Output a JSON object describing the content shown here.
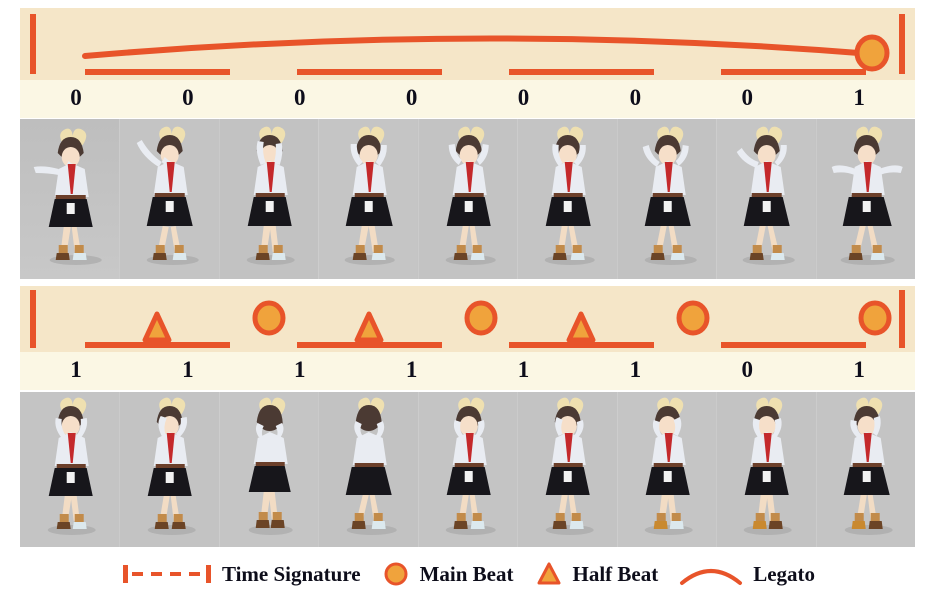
{
  "colors": {
    "page_bg": "#ffffff",
    "strip_bg": "#FBF7E4",
    "band_bg": "#F5E6C8",
    "accent_red": "#E8542A",
    "accent_orange": "#F0A33C",
    "frame_bg": "#C3C3C3",
    "digit": "#0d0d1a"
  },
  "rows": [
    {
      "name": "phrase-1",
      "notation": {
        "time_signature_bars": true,
        "legato": true,
        "digits": [
          "0",
          "0",
          "0",
          "0",
          "0",
          "0",
          "0",
          "1"
        ],
        "beam_groups": 4,
        "main_beats": [
          8
        ],
        "half_beats": []
      },
      "frames": {
        "count": 9,
        "caption": "dance motion frames row 1"
      }
    },
    {
      "name": "phrase-2",
      "notation": {
        "time_signature_bars": true,
        "legato": false,
        "digits": [
          "1",
          "1",
          "1",
          "1",
          "1",
          "1",
          "0",
          "1"
        ],
        "beam_groups": 4,
        "main_beats": [
          2,
          4,
          6,
          8
        ],
        "half_beats": [
          1,
          3,
          5
        ]
      },
      "frames": {
        "count": 9,
        "caption": "dance motion frames row 2"
      }
    }
  ],
  "legend": {
    "items": [
      {
        "glyph": "time-signature-glyph",
        "label": "Time Signature"
      },
      {
        "glyph": "main-beat-glyph",
        "label": "Main Beat"
      },
      {
        "glyph": "half-beat-glyph",
        "label": "Half Beat"
      },
      {
        "glyph": "legato-glyph",
        "label": "Legato"
      }
    ]
  }
}
